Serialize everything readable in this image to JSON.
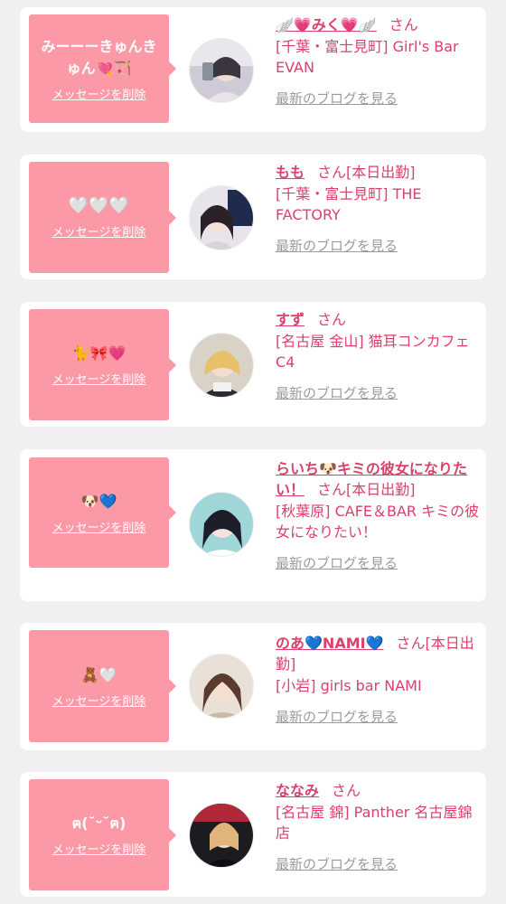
{
  "cards": [
    {
      "message": "みーーーきゅんきゅん💘🏹",
      "delete_label": "メッセージを削除",
      "name": "🪽💗みく💗🪽",
      "honorific": "さん",
      "status": "",
      "shop": "[千葉・富士見町] Girl's Bar EVAN",
      "blog_label": "最新のブログを見る"
    },
    {
      "message": "🤍🤍🤍",
      "delete_label": "メッセージを削除",
      "name": "もも",
      "honorific": "さん",
      "status": "[本日出勤]",
      "shop": "[千葉・富士見町] THE FACTORY",
      "blog_label": "最新のブログを見る"
    },
    {
      "message": "🐈🎀💗",
      "delete_label": "メッセージを削除",
      "name": "すず",
      "honorific": "さん",
      "status": "",
      "shop": "[名古屋 金山] 猫耳コンカフェ C4",
      "blog_label": "最新のブログを見る"
    },
    {
      "message": "🐶💙",
      "delete_label": "メッセージを削除",
      "name": "らいち🐶キミの彼女になりたい！",
      "honorific": "さん",
      "status": "[本日出勤]",
      "shop": "[秋葉原] CAFE＆BAR キミの彼女になりたい！",
      "blog_label": "最新のブログを見る"
    },
    {
      "message": "🧸🤍",
      "delete_label": "メッセージを削除",
      "name": "のあ💙NAMI💙",
      "honorific": "さん",
      "status": "[本日出勤]",
      "shop": "[小岩] girls bar NAMI",
      "blog_label": "最新のブログを見る"
    },
    {
      "message": "ฅ(˘ᵕ˘ฅ)",
      "delete_label": "メッセージを削除",
      "name": "ななみ",
      "honorific": "さん",
      "status": "",
      "shop": "[名古屋 錦] Panther 名古屋錦店",
      "blog_label": "最新のブログを見る"
    }
  ],
  "colors": {
    "bubble": "#fb9aa6",
    "accent": "#d9426a",
    "link_gray": "#9b9b9b",
    "background": "#f1eff1"
  }
}
